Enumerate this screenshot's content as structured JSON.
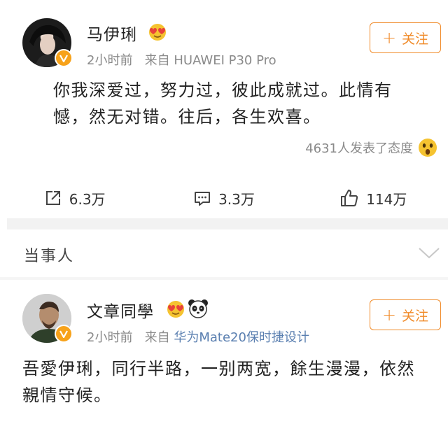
{
  "post1": {
    "username": "马伊琍",
    "time": "2小时前",
    "source_prefix": "来自",
    "device": "HUAWEI P30 Pro",
    "follow_label": "关注",
    "content_line1": "你我深爱过，努力过，彼此成就过。此情有",
    "content_line2": "憾，然无对错。往后，各生欢喜。",
    "reactions_text": "4631人发表了态度",
    "repost_count": "6.3万",
    "comment_count": "3.3万",
    "like_count": "114万"
  },
  "section": {
    "title": "当事人"
  },
  "post2": {
    "username": "文章同學",
    "time": "2小时前",
    "source_prefix": "来自",
    "device": "华为Mate20保时捷设计",
    "follow_label": "关注",
    "content_line1": "吾愛伊琍，同行半路，一别两宽，餘生漫漫，依然",
    "content_line2": "親情守候。"
  },
  "colors": {
    "accent_orange": "#f08a28",
    "verified_badge": "#f7a21a",
    "meta_gray": "#8a8a8a",
    "device_blue": "#5a7fb0",
    "divider_gray": "#f2f2f2"
  },
  "icons": [
    "verified-badge-icon",
    "emoji-hearts-icon",
    "panda-icon",
    "surprised-emoji-icon",
    "repost-icon",
    "comment-icon",
    "like-icon",
    "chevron-down-icon",
    "plus-icon"
  ]
}
